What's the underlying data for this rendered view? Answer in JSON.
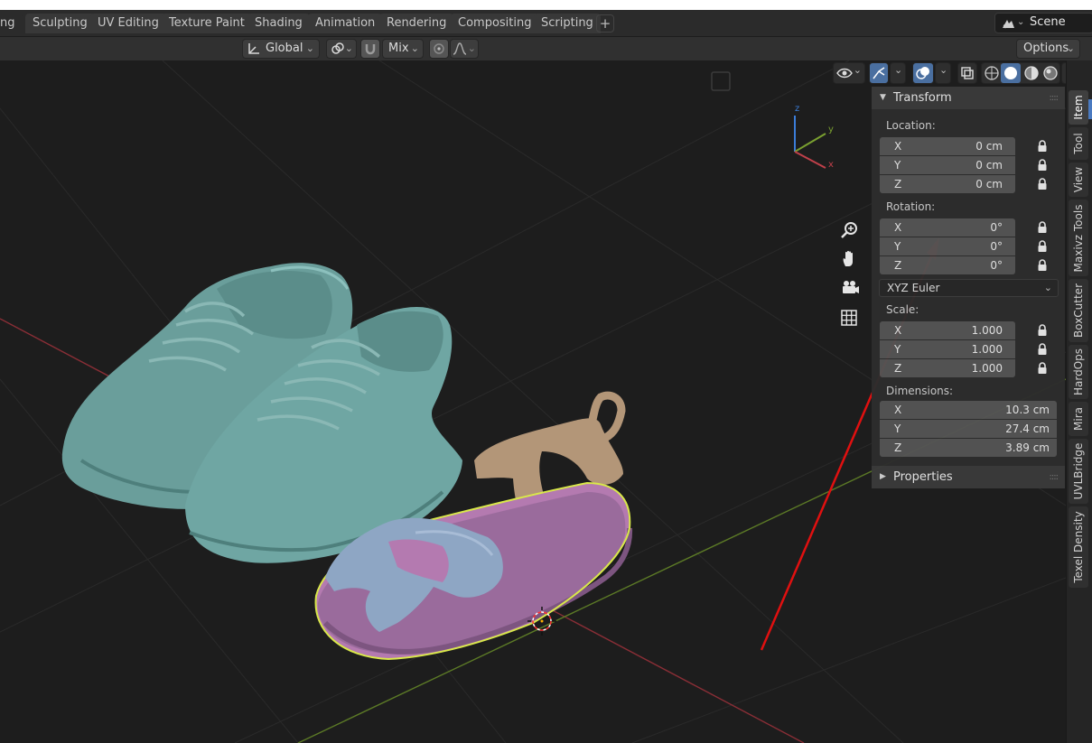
{
  "workspace_tabs": [
    "ng",
    "Sculpting",
    "UV Editing",
    "Texture Paint",
    "Shading",
    "Animation",
    "Rendering",
    "Compositing",
    "Scripting"
  ],
  "add_workspace_label": "+",
  "scene_label": "Scene",
  "header": {
    "orientation_label": "Global",
    "snap_target_label": "Mix",
    "options_label": "Options"
  },
  "gizmo_axes": {
    "x": "x",
    "y": "y",
    "z": "z"
  },
  "transform_panel": {
    "title": "Transform",
    "location": {
      "label": "Location:",
      "rows": [
        {
          "axis": "X",
          "value": "0 cm"
        },
        {
          "axis": "Y",
          "value": "0 cm"
        },
        {
          "axis": "Z",
          "value": "0 cm"
        }
      ]
    },
    "rotation": {
      "label": "Rotation:",
      "rows": [
        {
          "axis": "X",
          "value": "0°"
        },
        {
          "axis": "Y",
          "value": "0°"
        },
        {
          "axis": "Z",
          "value": "0°"
        }
      ],
      "mode": "XYZ Euler"
    },
    "scale": {
      "label": "Scale:",
      "rows": [
        {
          "axis": "X",
          "value": "1.000"
        },
        {
          "axis": "Y",
          "value": "1.000"
        },
        {
          "axis": "Z",
          "value": "1.000"
        }
      ]
    },
    "dimensions": {
      "label": "Dimensions:",
      "rows": [
        {
          "axis": "X",
          "value": "10.3 cm"
        },
        {
          "axis": "Y",
          "value": "27.4 cm"
        },
        {
          "axis": "Z",
          "value": "3.89 cm"
        }
      ]
    }
  },
  "properties_panel": {
    "title": "Properties"
  },
  "side_tabs": [
    "Item",
    "Tool",
    "View",
    "Maxivz Tools",
    "BoxCutter",
    "HardOps",
    "Mira",
    "UVLBridge",
    "Texel Density"
  ],
  "colors": {
    "viewport_bg": "#1d1d1d",
    "selection_outline": "#d9e84a",
    "annotation_arrow": "#e01010",
    "shoe_color": "#6fa6a3",
    "sandal_sole": "#b47ab0",
    "sandal_strap_front": "#8ea6c4",
    "sandal_strap_back": "#b89a7c",
    "x_axis": "#c0404a",
    "y_axis": "#7aa030",
    "z_axis": "#3b7dd8"
  }
}
